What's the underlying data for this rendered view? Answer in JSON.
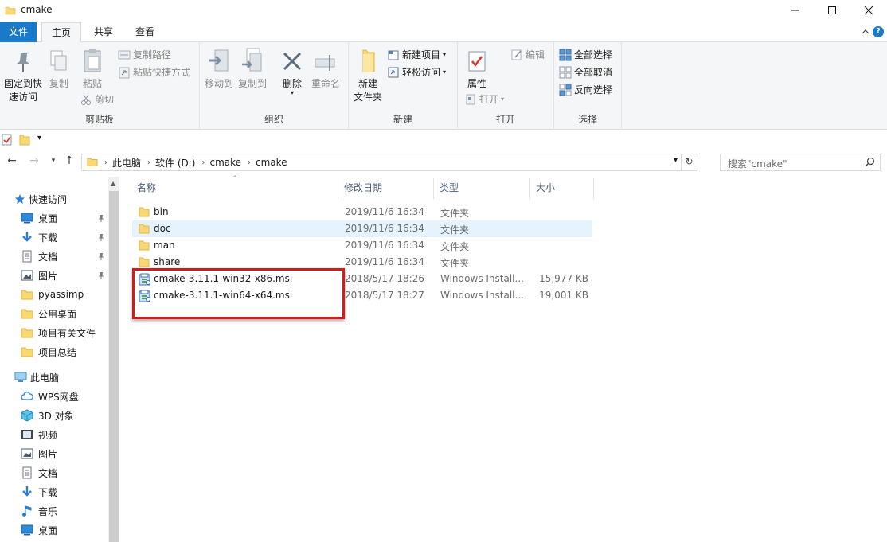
{
  "window": {
    "title": "cmake"
  },
  "tabs": {
    "file": "文件",
    "home": "主页",
    "share": "共享",
    "view": "查看"
  },
  "ribbon": {
    "clipboard": {
      "label": "剪贴板",
      "pin_quick_access_line1": "固定到快",
      "pin_quick_access_line2": "速访问",
      "copy": "复制",
      "paste": "粘贴",
      "copy_path": "复制路径",
      "paste_shortcut": "粘贴快捷方式",
      "cut": "剪切"
    },
    "organize": {
      "label": "组织",
      "move_to": "移动到",
      "copy_to": "复制到",
      "delete": "删除",
      "rename": "重命名"
    },
    "new": {
      "label": "新建",
      "new_folder_line1": "新建",
      "new_folder_line2": "文件夹",
      "new_item": "新建项目",
      "easy_access": "轻松访问"
    },
    "open": {
      "label": "打开",
      "properties": "属性",
      "open": "打开",
      "edit": "编辑"
    },
    "select": {
      "label": "选择",
      "select_all": "全部选择",
      "select_none": "全部取消",
      "invert_selection": "反向选择"
    }
  },
  "address": {
    "crumbs": [
      "此电脑",
      "软件 (D:)",
      "cmake",
      "cmake"
    ]
  },
  "search": {
    "placeholder": "搜索\"cmake\""
  },
  "navpane": {
    "quick_access": "快速访问",
    "items": [
      {
        "label": "桌面",
        "icon": "desktop-icon",
        "pinned": true
      },
      {
        "label": "下载",
        "icon": "download-icon",
        "pinned": true
      },
      {
        "label": "文档",
        "icon": "document-icon",
        "pinned": true
      },
      {
        "label": "图片",
        "icon": "pictures-icon",
        "pinned": true
      },
      {
        "label": "pyassimp",
        "icon": "folder-icon",
        "pinned": false
      },
      {
        "label": "公用桌面",
        "icon": "folder-icon",
        "pinned": false
      },
      {
        "label": "项目有关文件",
        "icon": "folder-icon",
        "pinned": false
      },
      {
        "label": "项目总结",
        "icon": "folder-icon",
        "pinned": false
      }
    ],
    "this_pc": "此电脑",
    "pc_items": [
      {
        "label": "WPS网盘",
        "icon": "cloud-icon"
      },
      {
        "label": "3D 对象",
        "icon": "3d-objects-icon"
      },
      {
        "label": "视频",
        "icon": "video-icon"
      },
      {
        "label": "图片",
        "icon": "pictures-icon"
      },
      {
        "label": "文档",
        "icon": "document-icon"
      },
      {
        "label": "下载",
        "icon": "download-icon"
      },
      {
        "label": "音乐",
        "icon": "music-icon"
      },
      {
        "label": "桌面",
        "icon": "desktop-icon"
      }
    ]
  },
  "filelist": {
    "columns": {
      "name": "名称",
      "date": "修改日期",
      "type": "类型",
      "size": "大小"
    },
    "rows": [
      {
        "name": "bin",
        "date": "2019/11/6 16:34",
        "type": "文件夹",
        "size": "",
        "kind": "folder"
      },
      {
        "name": "doc",
        "date": "2019/11/6 16:34",
        "type": "文件夹",
        "size": "",
        "kind": "folder"
      },
      {
        "name": "man",
        "date": "2019/11/6 16:34",
        "type": "文件夹",
        "size": "",
        "kind": "folder"
      },
      {
        "name": "share",
        "date": "2019/11/6 16:34",
        "type": "文件夹",
        "size": "",
        "kind": "folder"
      },
      {
        "name": "cmake-3.11.1-win32-x86.msi",
        "date": "2018/5/17 18:26",
        "type": "Windows Install...",
        "size": "15,977 KB",
        "kind": "msi"
      },
      {
        "name": "cmake-3.11.1-win64-x64.msi",
        "date": "2018/5/17 18:27",
        "type": "Windows Install...",
        "size": "19,001 KB",
        "kind": "msi"
      }
    ]
  },
  "colors": {
    "accent": "#1979ca",
    "highlight": "#d41a1a",
    "folder": "#f8d775",
    "selection": "#e5f3ff"
  }
}
